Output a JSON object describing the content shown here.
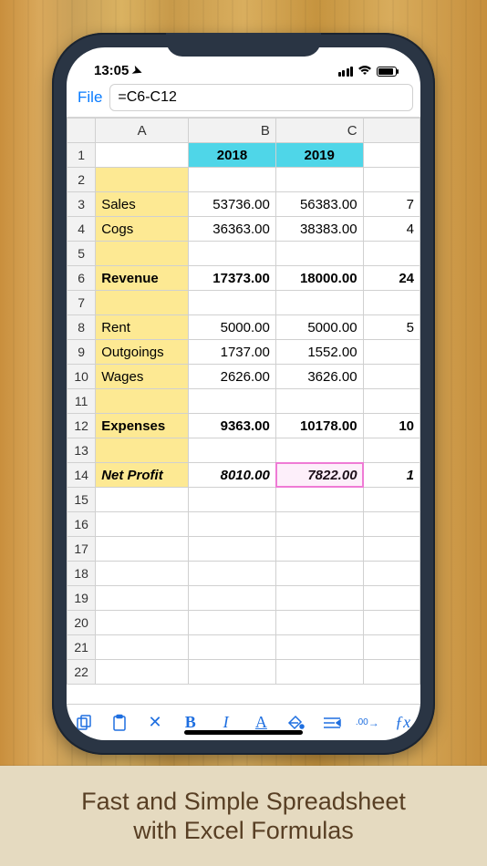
{
  "status": {
    "time": "13:05"
  },
  "formula_bar": {
    "file_label": "File",
    "formula": "=C6-C12"
  },
  "columns": [
    "A",
    "B",
    "C"
  ],
  "rows": {
    "1": {
      "A": "",
      "B": "2018",
      "C": "2019",
      "D": "",
      "a_lbl": false,
      "year": true
    },
    "2": {
      "A": "",
      "B": "",
      "C": "",
      "D": "",
      "a_lbl": true
    },
    "3": {
      "A": "Sales",
      "B": "53736.00",
      "C": "56383.00",
      "D": "7",
      "a_lbl": true
    },
    "4": {
      "A": "Cogs",
      "B": "36363.00",
      "C": "38383.00",
      "D": "4",
      "a_lbl": true
    },
    "5": {
      "A": "",
      "B": "",
      "C": "",
      "D": "",
      "a_lbl": true
    },
    "6": {
      "A": "Revenue",
      "B": "17373.00",
      "C": "18000.00",
      "D": "24",
      "a_lbl": true,
      "bold": true
    },
    "7": {
      "A": "",
      "B": "",
      "C": "",
      "D": "",
      "a_lbl": true
    },
    "8": {
      "A": "Rent",
      "B": "5000.00",
      "C": "5000.00",
      "D": "5",
      "a_lbl": true
    },
    "9": {
      "A": "Outgoings",
      "B": "1737.00",
      "C": "1552.00",
      "D": "",
      "a_lbl": true
    },
    "10": {
      "A": "Wages",
      "B": "2626.00",
      "C": "3626.00",
      "D": "",
      "a_lbl": true
    },
    "11": {
      "A": "",
      "B": "",
      "C": "",
      "D": "",
      "a_lbl": true
    },
    "12": {
      "A": "Expenses",
      "B": "9363.00",
      "C": "10178.00",
      "D": "10",
      "a_lbl": true,
      "bold": true
    },
    "13": {
      "A": "",
      "B": "",
      "C": "",
      "D": "",
      "a_lbl": true
    },
    "14": {
      "A": "Net Profit",
      "B": "8010.00",
      "C": "7822.00",
      "D": "1",
      "a_lbl": true,
      "bold": true,
      "ital": true,
      "sel": "C"
    },
    "15": {
      "A": "",
      "B": "",
      "C": "",
      "D": ""
    },
    "16": {
      "A": "",
      "B": "",
      "C": "",
      "D": ""
    },
    "17": {
      "A": "",
      "B": "",
      "C": "",
      "D": ""
    },
    "18": {
      "A": "",
      "B": "",
      "C": "",
      "D": ""
    },
    "19": {
      "A": "",
      "B": "",
      "C": "",
      "D": ""
    },
    "20": {
      "A": "",
      "B": "",
      "C": "",
      "D": ""
    },
    "21": {
      "A": "",
      "B": "",
      "C": "",
      "D": ""
    },
    "22": {
      "A": "",
      "B": "",
      "C": "",
      "D": ""
    }
  },
  "toolbar": {
    "copy": "⎘",
    "paste": "📋",
    "clear": "✕",
    "bold": "B",
    "italic": "I",
    "fontcolor": "A",
    "fillcolor": "◮",
    "align": "↤",
    "decimals": ".00→",
    "formula": "ƒx"
  },
  "caption_line1": "Fast and Simple Spreadsheet",
  "caption_line2": "with Excel Formulas"
}
